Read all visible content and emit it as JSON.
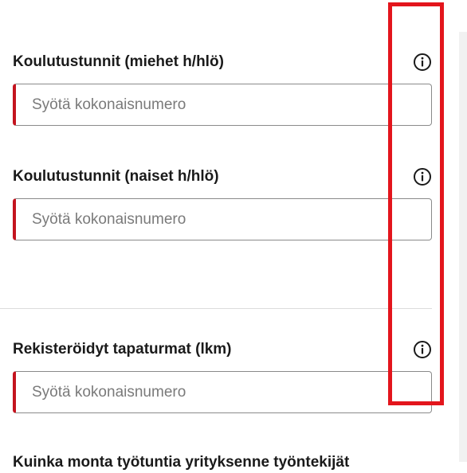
{
  "fields": [
    {
      "label": "Koulutustunnit (miehet h/hlö)",
      "placeholder": "Syötä kokonaisnumero",
      "value": "",
      "info_icon": "info-circle-icon"
    },
    {
      "label": "Koulutustunnit (naiset h/hlö)",
      "placeholder": "Syötä kokonaisnumero",
      "value": "",
      "info_icon": "info-circle-icon"
    },
    {
      "label": "Rekisteröidyt tapaturmat (lkm)",
      "placeholder": "Syötä kokonaisnumero",
      "value": "",
      "info_icon": "info-circle-icon"
    }
  ],
  "next_question_label": "Kuinka monta työtuntia yrityksenne työntekijät",
  "colors": {
    "required_accent": "#c4141f",
    "highlight_outline": "#e3151c",
    "input_border": "#8a8a8a",
    "placeholder_text": "#7a7a7a"
  }
}
